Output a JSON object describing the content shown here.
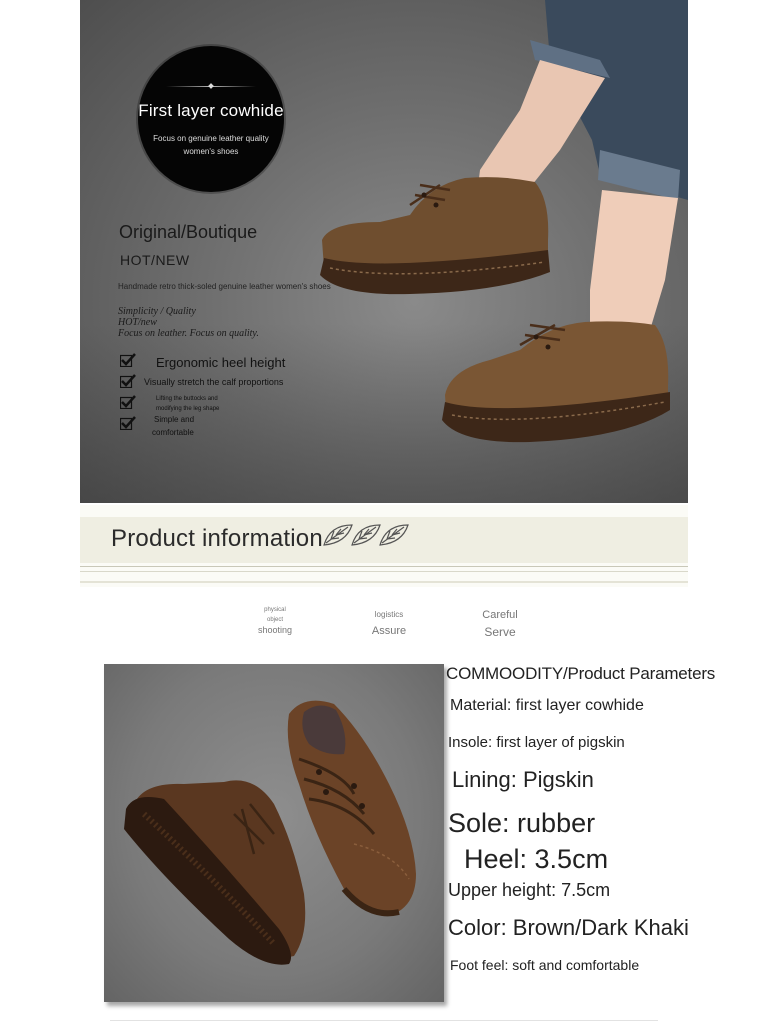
{
  "hero": {
    "badge": {
      "title": "First layer cowhide",
      "subtitle_line1": "Focus on genuine leather quality",
      "subtitle_line2": "women's shoes"
    },
    "original": "Original/Boutique",
    "hot_new": "HOT/NEW",
    "handmade": "Handmade retro thick-soled genuine leather women's shoes",
    "simplicity": "Simplicity / Quality",
    "hot_new_small": "HOT/new",
    "focus": "Focus on leather. Focus on quality.",
    "features": [
      {
        "line1": "Ergonomic heel height",
        "line2": ""
      },
      {
        "line1": "Visually stretch the calf proportions",
        "line2": ""
      },
      {
        "line1": "Lifting the buttocks and",
        "line2": "modifying the leg shape"
      },
      {
        "line1": "Simple and",
        "line2": "comfortable"
      }
    ]
  },
  "product_info": {
    "title": "Product information"
  },
  "services": [
    {
      "line1": "physical",
      "line2": "object",
      "line3": "shooting"
    },
    {
      "line1": "logistics",
      "line2": "Assure"
    },
    {
      "line1": "Careful",
      "line2": "Serve"
    }
  ],
  "parameters": {
    "heading": "COMMOODITY/Product Parameters",
    "material": "Material: first layer cowhide",
    "insole": "Insole: first layer of pigskin",
    "lining": "Lining: Pigskin",
    "sole": "Sole: rubber",
    "heel": "Heel: 3.5cm",
    "upper_height": "Upper height: 7.5cm",
    "color": "Color: Brown/Dark Khaki",
    "foot_feel": "Foot feel: soft and comfortable"
  },
  "colors": {
    "leather_brown": "#6b4a2c",
    "dark_brown": "#4a2e1a",
    "banner_bg": "#efeee2",
    "badge_bg": "#050505"
  }
}
